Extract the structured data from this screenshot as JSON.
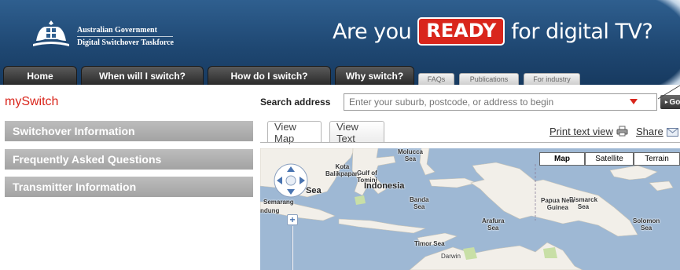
{
  "header": {
    "gov_line1": "Australian Government",
    "gov_line2": "Digital Switchover Taskforce",
    "tagline_before": "Are you",
    "tagline_badge": "READY",
    "tagline_after": "for digital TV?"
  },
  "nav": {
    "main_tabs": [
      "Home",
      "When will I switch?",
      "How do I switch?",
      "Why switch?"
    ],
    "sub_tabs": [
      "FAQs",
      "Publications",
      "For industry"
    ]
  },
  "sidebar": {
    "brand": "mySwitch",
    "items": [
      "Switchover Information",
      "Frequently Asked Questions",
      "Transmitter Information"
    ]
  },
  "search": {
    "label": "Search address",
    "placeholder": "Enter your suburb, postcode, or address to begin",
    "go_label": "Go"
  },
  "view": {
    "tabs": [
      "View Map",
      "View Text"
    ],
    "active_tab": "View Map",
    "print_label": "Print text view",
    "share_label": "Share"
  },
  "map": {
    "types": [
      "Map",
      "Satellite",
      "Terrain"
    ],
    "active_type": "Map",
    "labels": {
      "gulf_tomini": "Gulf of\nTomini",
      "molucca_sea": "Molucca\nSea",
      "kota_balikpapan": "Kota\nBalikpapan",
      "sea_fragment": "Sea",
      "semarang": "Semarang",
      "bandung": "ndung",
      "indonesia": "Indonesia",
      "banda_sea": "Banda\nSea",
      "bismarck_sea": "Bismarck\nSea",
      "papua_new_guinea": "Papua New\nGuinea",
      "arafura_sea": "Arafura\nSea",
      "solomon_sea": "Solomon\nSea",
      "timor_sea": "Timor Sea",
      "darwin": "Darwin"
    }
  },
  "colors": {
    "brand_red": "#d9261c",
    "header_blue": "#1f4873",
    "sidebar_gray": "#b0b0b0",
    "map_water": "#9eb8d4",
    "map_land": "#f2efe9"
  },
  "icons": [
    "coat-of-arms-icon",
    "dropdown-arrow-icon",
    "printer-icon",
    "mail-icon",
    "pan-control-icon",
    "zoom-in-icon"
  ]
}
